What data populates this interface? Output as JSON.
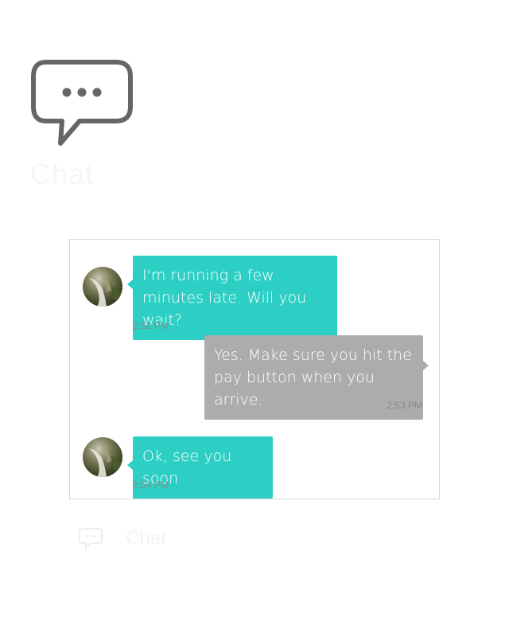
{
  "header": {
    "icon": "chat-bubble-icon",
    "title": "Chat"
  },
  "conversation": {
    "messages": [
      {
        "direction": "incoming",
        "text": "I'm running a few minutes late. Will you wait?",
        "time": "2:52 PM"
      },
      {
        "direction": "outgoing",
        "text": "Yes. Make sure you hit the pay button when you arrive.",
        "time": "2:53 PM"
      },
      {
        "direction": "incoming",
        "text": "Ok, see you soon",
        "time": "2:54 PM"
      }
    ]
  },
  "footer": {
    "icon": "chat-bubble-icon",
    "text": "Chat"
  },
  "colors": {
    "incoming_bubble": "#2dcfc4",
    "outgoing_bubble": "#acacac",
    "icon_gray": "#666666"
  }
}
